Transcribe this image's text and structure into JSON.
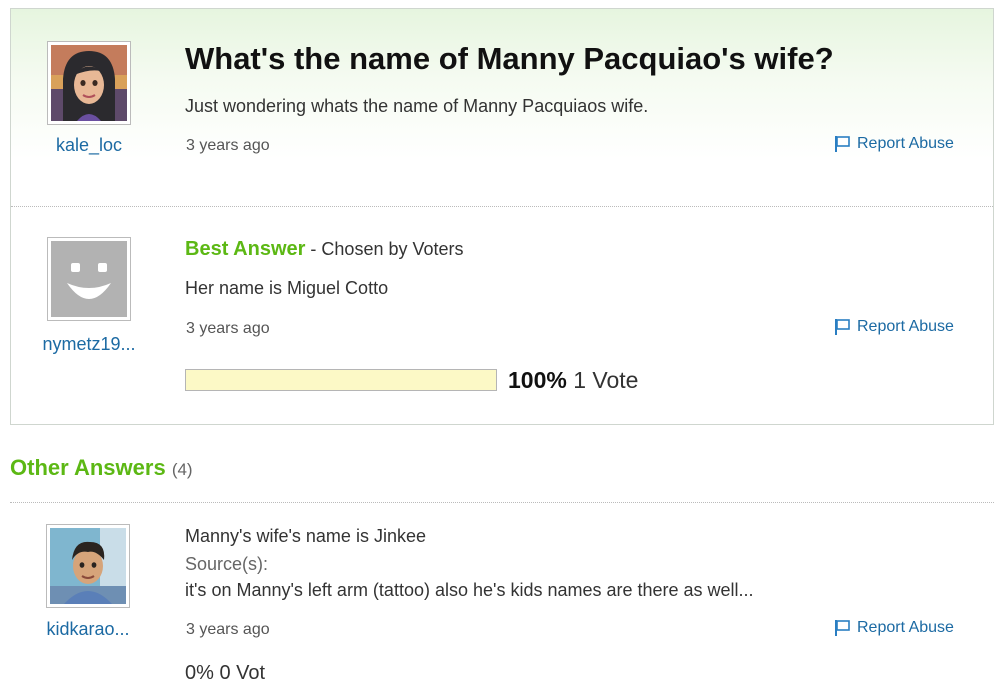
{
  "question": {
    "title": "What's the name of Manny Pacquiao's wife?",
    "details": "Just wondering whats the name of Manny Pacquiaos wife.",
    "asker": "kale_loc",
    "time": "3 years ago",
    "report_label": "Report Abuse"
  },
  "best_answer": {
    "label": "Best Answer",
    "chosen_by": " - Chosen by Voters",
    "text": "Her name is Miguel Cotto",
    "author": "nymetz19...",
    "time": "3 years ago",
    "report_label": "Report Abuse",
    "vote_percent": "100%",
    "vote_fraction": 1.0,
    "vote_count": "1 Vote"
  },
  "other_answers": {
    "heading": "Other Answers",
    "count": "(4)",
    "items": [
      {
        "text": "Manny's wife's name is Jinkee",
        "source_label": "Source(s):",
        "source_text": "it's on Manny's left arm (tattoo) also he's kids names are there as well...",
        "author": "kidkarao...",
        "time": "3 years ago",
        "report_label": "Report Abuse",
        "vote_partial": "0% 0 Vot"
      }
    ]
  },
  "colors": {
    "accent_green": "#5cb814",
    "link_blue": "#1c6aa3"
  },
  "icons": {
    "report": "flag-icon",
    "default_avatar": "smiley-face-icon"
  }
}
